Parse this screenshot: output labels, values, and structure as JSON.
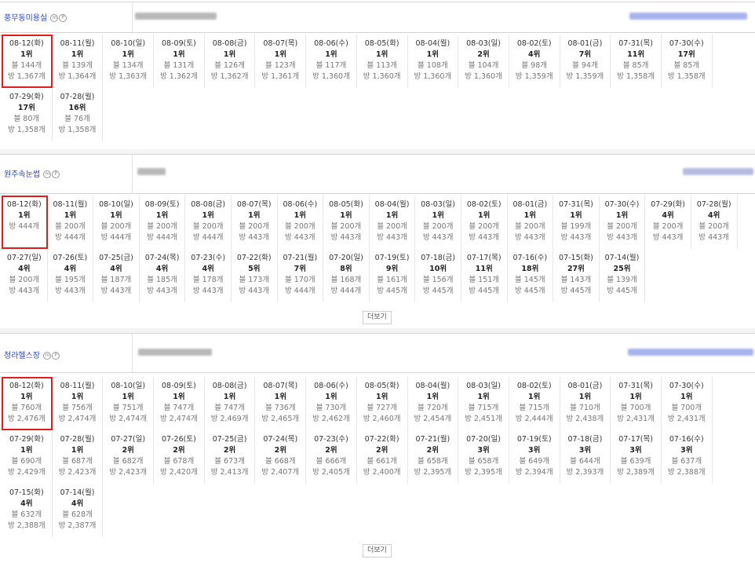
{
  "sections": [
    {
      "title": "풍무동미용실",
      "badge_m": "m",
      "badge_p": "P",
      "more_label": "",
      "items": [
        {
          "date": "08-12(화)",
          "rank": "1위",
          "blog": "블 144개",
          "bang": "방 1,367개"
        },
        {
          "date": "08-11(월)",
          "rank": "1위",
          "blog": "블 139개",
          "bang": "방 1,364개"
        },
        {
          "date": "08-10(일)",
          "rank": "1위",
          "blog": "블 134개",
          "bang": "방 1,363개"
        },
        {
          "date": "08-09(토)",
          "rank": "1위",
          "blog": "블 131개",
          "bang": "방 1,362개"
        },
        {
          "date": "08-08(금)",
          "rank": "1위",
          "blog": "블 126개",
          "bang": "방 1,362개"
        },
        {
          "date": "08-07(목)",
          "rank": "1위",
          "blog": "블 123개",
          "bang": "방 1,361개"
        },
        {
          "date": "08-06(수)",
          "rank": "1위",
          "blog": "블 117개",
          "bang": "방 1,360개"
        },
        {
          "date": "08-05(화)",
          "rank": "1위",
          "blog": "블 113개",
          "bang": "방 1,360개"
        },
        {
          "date": "08-04(월)",
          "rank": "1위",
          "blog": "블 108개",
          "bang": "방 1,360개"
        },
        {
          "date": "08-03(일)",
          "rank": "2위",
          "blog": "블 104개",
          "bang": "방 1,360개"
        },
        {
          "date": "08-02(토)",
          "rank": "4위",
          "blog": "블 98개",
          "bang": "방 1,359개"
        },
        {
          "date": "08-01(금)",
          "rank": "7위",
          "blog": "블 94개",
          "bang": "방 1,359개"
        },
        {
          "date": "07-31(목)",
          "rank": "11위",
          "blog": "블 85개",
          "bang": "방 1,358개"
        },
        {
          "date": "07-30(수)",
          "rank": "17위",
          "blog": "블 85개",
          "bang": "방 1,358개"
        },
        {
          "date": "07-29(화)",
          "rank": "17위",
          "blog": "블 80개",
          "bang": "방 1,358개"
        },
        {
          "date": "07-28(월)",
          "rank": "16위",
          "blog": "블 76개",
          "bang": "방 1,358개"
        }
      ]
    },
    {
      "title": "원주속눈썹",
      "badge_m": "m",
      "badge_p": "P",
      "more_label": "더보기",
      "items": [
        {
          "date": "08-12(화)",
          "rank": "1위",
          "blog": "",
          "bang": "방 444개"
        },
        {
          "date": "08-11(월)",
          "rank": "1위",
          "blog": "블 200개",
          "bang": "방 444개"
        },
        {
          "date": "08-10(일)",
          "rank": "1위",
          "blog": "블 200개",
          "bang": "방 444개"
        },
        {
          "date": "08-09(토)",
          "rank": "1위",
          "blog": "블 200개",
          "bang": "방 444개"
        },
        {
          "date": "08-08(금)",
          "rank": "1위",
          "blog": "블 200개",
          "bang": "방 444개"
        },
        {
          "date": "08-07(목)",
          "rank": "1위",
          "blog": "블 200개",
          "bang": "방 443개"
        },
        {
          "date": "08-06(수)",
          "rank": "1위",
          "blog": "블 200개",
          "bang": "방 443개"
        },
        {
          "date": "08-05(화)",
          "rank": "1위",
          "blog": "블 200개",
          "bang": "방 443개"
        },
        {
          "date": "08-04(월)",
          "rank": "1위",
          "blog": "블 200개",
          "bang": "방 443개"
        },
        {
          "date": "08-03(일)",
          "rank": "1위",
          "blog": "블 200개",
          "bang": "방 443개"
        },
        {
          "date": "08-02(토)",
          "rank": "1위",
          "blog": "블 200개",
          "bang": "방 443개"
        },
        {
          "date": "08-01(금)",
          "rank": "1위",
          "blog": "블 200개",
          "bang": "방 443개"
        },
        {
          "date": "07-31(목)",
          "rank": "1위",
          "blog": "블 199개",
          "bang": "방 443개"
        },
        {
          "date": "07-30(수)",
          "rank": "1위",
          "blog": "블 200개",
          "bang": "방 443개"
        },
        {
          "date": "07-29(화)",
          "rank": "4위",
          "blog": "블 200개",
          "bang": "방 443개"
        },
        {
          "date": "07-28(월)",
          "rank": "4위",
          "blog": "블 200개",
          "bang": "방 443개"
        },
        {
          "date": "07-27(일)",
          "rank": "4위",
          "blog": "블 200개",
          "bang": "방 443개"
        },
        {
          "date": "07-26(토)",
          "rank": "4위",
          "blog": "블 195개",
          "bang": "방 443개"
        },
        {
          "date": "07-25(금)",
          "rank": "4위",
          "blog": "블 187개",
          "bang": "방 443개"
        },
        {
          "date": "07-24(목)",
          "rank": "4위",
          "blog": "블 185개",
          "bang": "방 443개"
        },
        {
          "date": "07-23(수)",
          "rank": "4위",
          "blog": "블 178개",
          "bang": "방 443개"
        },
        {
          "date": "07-22(화)",
          "rank": "5위",
          "blog": "블 173개",
          "bang": "방 443개"
        },
        {
          "date": "07-21(월)",
          "rank": "7위",
          "blog": "블 170개",
          "bang": "방 444개"
        },
        {
          "date": "07-20(일)",
          "rank": "8위",
          "blog": "블 168개",
          "bang": "방 444개"
        },
        {
          "date": "07-19(토)",
          "rank": "9위",
          "blog": "블 161개",
          "bang": "방 445개"
        },
        {
          "date": "07-18(금)",
          "rank": "10위",
          "blog": "블 156개",
          "bang": "방 445개"
        },
        {
          "date": "07-17(목)",
          "rank": "11위",
          "blog": "블 151개",
          "bang": "방 445개"
        },
        {
          "date": "07-16(수)",
          "rank": "18위",
          "blog": "블 145개",
          "bang": "방 445개"
        },
        {
          "date": "07-15(화)",
          "rank": "27위",
          "blog": "블 143개",
          "bang": "방 445개"
        },
        {
          "date": "07-14(월)",
          "rank": "25위",
          "blog": "블 139개",
          "bang": "방 445개"
        }
      ]
    },
    {
      "title": "청라헬스장",
      "badge_m": "m",
      "badge_p": "P",
      "more_label": "더보기",
      "items": [
        {
          "date": "08-12(화)",
          "rank": "1위",
          "blog": "블 760개",
          "bang": "방 2,476개"
        },
        {
          "date": "08-11(월)",
          "rank": "1위",
          "blog": "블 756개",
          "bang": "방 2,474개"
        },
        {
          "date": "08-10(일)",
          "rank": "1위",
          "blog": "블 751개",
          "bang": "방 2,474개"
        },
        {
          "date": "08-09(토)",
          "rank": "1위",
          "blog": "블 747개",
          "bang": "방 2,474개"
        },
        {
          "date": "08-08(금)",
          "rank": "1위",
          "blog": "블 747개",
          "bang": "방 2,469개"
        },
        {
          "date": "08-07(목)",
          "rank": "1위",
          "blog": "블 736개",
          "bang": "방 2,465개"
        },
        {
          "date": "08-06(수)",
          "rank": "1위",
          "blog": "블 730개",
          "bang": "방 2,462개"
        },
        {
          "date": "08-05(화)",
          "rank": "1위",
          "blog": "블 727개",
          "bang": "방 2,460개"
        },
        {
          "date": "08-04(월)",
          "rank": "1위",
          "blog": "블 720개",
          "bang": "방 2,454개"
        },
        {
          "date": "08-03(일)",
          "rank": "1위",
          "blog": "블 715개",
          "bang": "방 2,451개"
        },
        {
          "date": "08-02(토)",
          "rank": "1위",
          "blog": "블 715개",
          "bang": "방 2,444개"
        },
        {
          "date": "08-01(금)",
          "rank": "1위",
          "blog": "블 710개",
          "bang": "방 2,438개"
        },
        {
          "date": "07-31(목)",
          "rank": "1위",
          "blog": "블 700개",
          "bang": "방 2,431개"
        },
        {
          "date": "07-30(수)",
          "rank": "1위",
          "blog": "블 700개",
          "bang": "방 2,431개"
        },
        {
          "date": "07-29(화)",
          "rank": "1위",
          "blog": "블 690개",
          "bang": "방 2,429개"
        },
        {
          "date": "07-28(월)",
          "rank": "1위",
          "blog": "블 687개",
          "bang": "방 2,423개"
        },
        {
          "date": "07-27(일)",
          "rank": "2위",
          "blog": "블 682개",
          "bang": "방 2,423개"
        },
        {
          "date": "07-26(토)",
          "rank": "2위",
          "blog": "블 678개",
          "bang": "방 2,420개"
        },
        {
          "date": "07-25(금)",
          "rank": "2위",
          "blog": "블 673개",
          "bang": "방 2,413개"
        },
        {
          "date": "07-24(목)",
          "rank": "2위",
          "blog": "블 668개",
          "bang": "방 2,407개"
        },
        {
          "date": "07-23(수)",
          "rank": "2위",
          "blog": "블 666개",
          "bang": "방 2,405개"
        },
        {
          "date": "07-22(화)",
          "rank": "2위",
          "blog": "블 661개",
          "bang": "방 2,400개"
        },
        {
          "date": "07-21(월)",
          "rank": "2위",
          "blog": "블 658개",
          "bang": "방 2,395개"
        },
        {
          "date": "07-20(일)",
          "rank": "3위",
          "blog": "블 658개",
          "bang": "방 2,395개"
        },
        {
          "date": "07-19(토)",
          "rank": "3위",
          "blog": "블 649개",
          "bang": "방 2,394개"
        },
        {
          "date": "07-18(금)",
          "rank": "3위",
          "blog": "블 644개",
          "bang": "방 2,393개"
        },
        {
          "date": "07-17(목)",
          "rank": "3위",
          "blog": "블 639개",
          "bang": "방 2,389개"
        },
        {
          "date": "07-16(수)",
          "rank": "3위",
          "blog": "블 637개",
          "bang": "방 2,388개"
        },
        {
          "date": "07-15(화)",
          "rank": "4위",
          "blog": "블 632개",
          "bang": "방 2,388개"
        },
        {
          "date": "07-14(월)",
          "rank": "4위",
          "blog": "블 628개",
          "bang": "방 2,387개"
        }
      ]
    }
  ]
}
